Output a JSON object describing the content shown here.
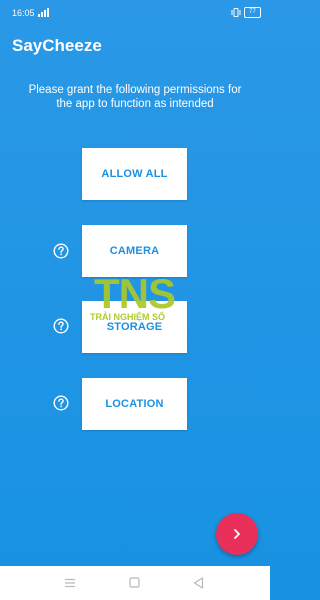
{
  "status_bar": {
    "time": "16:05",
    "battery": "77",
    "icons": [
      "signal-icon",
      "vibrate-icon",
      "battery-icon"
    ]
  },
  "app": {
    "title": "SayCheeze"
  },
  "message": "Please grant the following permissions for the app to function as intended",
  "buttons": {
    "allow_all": "ALLOW ALL",
    "camera": "CAMERA",
    "storage": "STORAGE",
    "location": "LOCATION"
  },
  "watermark": {
    "logo": "TNS",
    "text": "TRẢI NGHIỆM SỐ"
  },
  "fab": {
    "icon": "chevron-right-icon",
    "color": "#e9305a"
  },
  "colors": {
    "background": "#1e93e3",
    "button_text": "#1e90e0"
  },
  "nav_bar": {
    "icons": [
      "menu-icon",
      "home-icon",
      "back-icon"
    ]
  }
}
